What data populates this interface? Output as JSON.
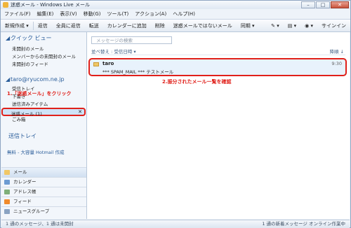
{
  "window": {
    "title": "迷惑メール - Windows Live メール"
  },
  "menu": [
    "ファイル(F)",
    "編集(E)",
    "表示(V)",
    "移動(G)",
    "ツール(T)",
    "アクション(A)",
    "ヘルプ(H)"
  ],
  "toolbar": {
    "items": [
      "新規作成 ▾",
      "返信",
      "全員に返信",
      "転送",
      "カレンダーに追加",
      "削除",
      "迷惑メールではないメール",
      "同期 ▾"
    ],
    "signin": "サインイン"
  },
  "sidebar": {
    "quick_view": "クイック ビュー",
    "quick_items": [
      "未開封のメール",
      "メンバーからの未開封のメール",
      "未開封のフィード"
    ],
    "account": "taro@ryucom.ne.jp",
    "folders": [
      "受信トレイ",
      "下書き",
      "送信済みアイテム"
    ],
    "junk_label": "迷惑メール (1)",
    "trash_label": "ごみ箱",
    "outbox": "送信トレイ",
    "hotmail_link": "無料 - 大容量 Hotmail 作成",
    "nav": [
      "メール",
      "カレンダー",
      "アドレス帳",
      "フィード",
      "ニュースグループ"
    ]
  },
  "main": {
    "search_placeholder": "メッセージの検索",
    "sort_label": "並べ替え : 受信日時 ▾",
    "sort_right": "降順 ↓",
    "message": {
      "from": "taro",
      "subject": "*** SPAM_MAIL *** テストメール",
      "time": "9:30"
    }
  },
  "annotations": {
    "step1": "1.「迷惑メール」をクリック",
    "step2": "2.振分されたメール一覧を確認"
  },
  "status": {
    "left": "1 通のメッセージ、1 通は未開封",
    "right": "1 通の新着メッセージ  オンライン作業中"
  },
  "colors": {
    "highlight_red": "#e0201a",
    "accent_blue": "#2a5d9a",
    "selection": "#cfe3f7"
  }
}
